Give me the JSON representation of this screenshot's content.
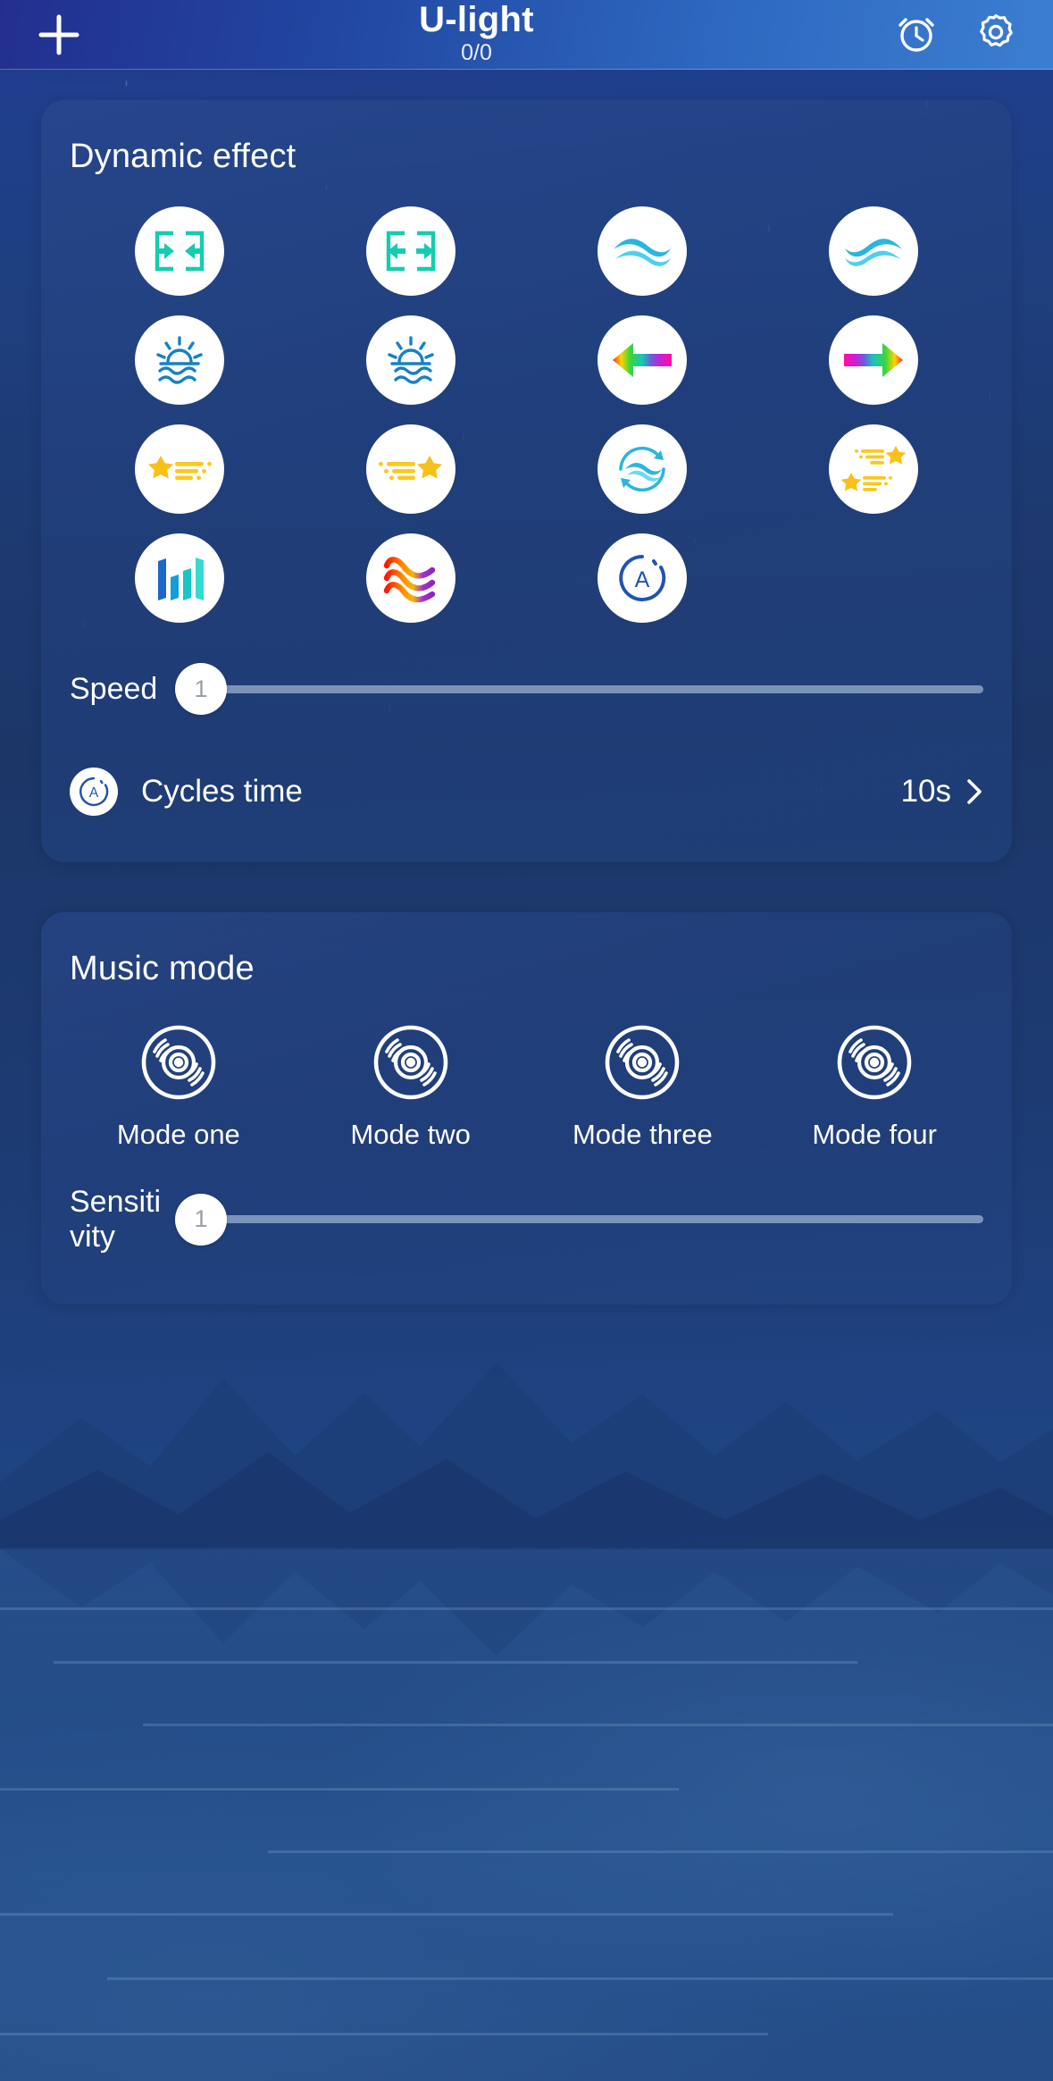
{
  "header": {
    "add_icon": "plus-icon",
    "title": "U-light",
    "subtitle": "0/0",
    "alarm_icon": "alarm-clock-icon",
    "settings_icon": "gear-icon"
  },
  "dynamic_effect": {
    "title": "Dynamic effect",
    "effects": [
      {
        "name": "move-outward",
        "icon": "arrows-outward-boxes-icon"
      },
      {
        "name": "move-inward",
        "icon": "arrows-inward-boxes-icon"
      },
      {
        "name": "wave-left",
        "icon": "wave-left-icon"
      },
      {
        "name": "wave-right",
        "icon": "wave-right-icon"
      },
      {
        "name": "sunrise-left",
        "icon": "sunrise-water-left-icon"
      },
      {
        "name": "sunrise-right",
        "icon": "sunrise-water-right-icon"
      },
      {
        "name": "rainbow-arrow-left",
        "icon": "rainbow-arrow-left-icon"
      },
      {
        "name": "rainbow-arrow-right",
        "icon": "rainbow-arrow-right-icon"
      },
      {
        "name": "shooting-star-right",
        "icon": "shooting-star-right-icon"
      },
      {
        "name": "shooting-star-left",
        "icon": "shooting-star-left-icon"
      },
      {
        "name": "wave-cycle",
        "icon": "wave-cycle-arrows-icon"
      },
      {
        "name": "double-shooting-star",
        "icon": "double-shooting-star-icon"
      },
      {
        "name": "level-meter",
        "icon": "bar-meter-icon"
      },
      {
        "name": "color-waves",
        "icon": "color-waves-icon"
      },
      {
        "name": "auto-mode",
        "icon": "auto-a-circle-icon"
      }
    ],
    "speed": {
      "label": "Speed",
      "value": "1",
      "percent": 0
    },
    "cycles": {
      "icon": "auto-a-circle-icon",
      "label": "Cycles time",
      "value": "10s",
      "chevron": "chevron-right-icon"
    }
  },
  "music_mode": {
    "title": "Music mode",
    "modes": [
      {
        "icon": "vinyl-record-icon",
        "label": "Mode one"
      },
      {
        "icon": "vinyl-record-icon",
        "label": "Mode two"
      },
      {
        "icon": "vinyl-record-icon",
        "label": "Mode three"
      },
      {
        "icon": "vinyl-record-icon",
        "label": "Mode four"
      }
    ],
    "sensitivity": {
      "label_line1": "Sensiti",
      "label_line2": "vity",
      "value": "1",
      "percent": 0
    }
  },
  "colors": {
    "accent_teal": "#13cdb0",
    "accent_cyan": "#29b6e0",
    "accent_blue": "#1976c4",
    "accent_yellow": "#f9c017",
    "deep_blue": "#1e4a96",
    "card_bg": "#2a498c",
    "text": "#ffffff"
  }
}
